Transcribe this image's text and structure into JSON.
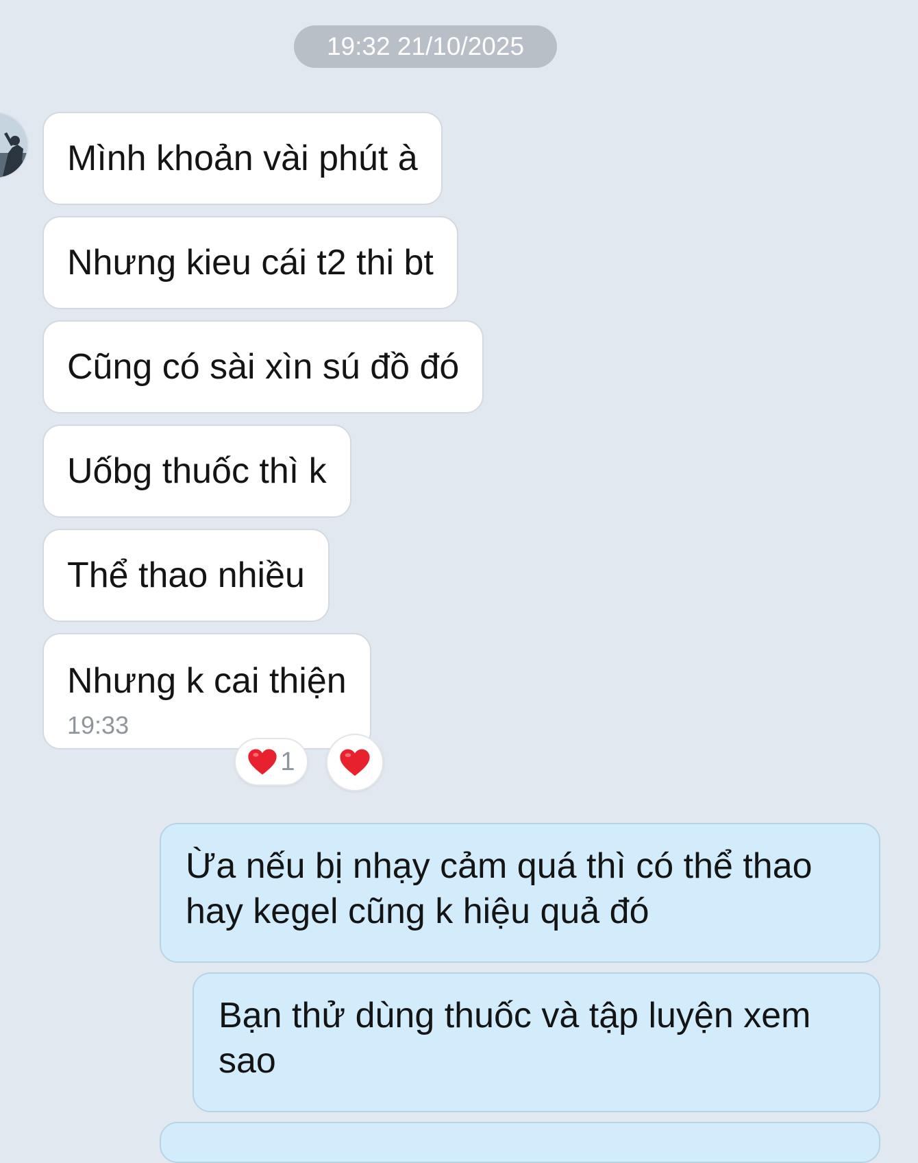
{
  "conversation": {
    "date_separator": "19:32 21/10/2025",
    "incoming_messages": [
      {
        "text": "Mình khoản vài phút à"
      },
      {
        "text": "Nhưng kieu cái t2 thi bt"
      },
      {
        "text": "Cũng có sài xìn sú đồ đó"
      },
      {
        "text": "Uốbg thuốc thì k"
      },
      {
        "text": "Thể thao nhiều"
      },
      {
        "text": "Nhưng k cai thiện",
        "time": "19:33"
      }
    ],
    "reactions": {
      "summary": {
        "icon": "heart-icon",
        "count": "1"
      },
      "quick_react": {
        "icon": "heart-icon"
      }
    },
    "outgoing_messages": [
      {
        "text": "Ừa nếu bị nhạy cảm quá thì có thể thao hay kegel cũng k hiệu quả đó"
      },
      {
        "text": "Bạn thử dùng thuốc và tập luyện xem sao"
      }
    ]
  },
  "colors": {
    "background": "#e2e8f0",
    "incoming_bubble": "#ffffff",
    "outgoing_bubble": "#d3ecfb",
    "heart": "#e8212e"
  }
}
